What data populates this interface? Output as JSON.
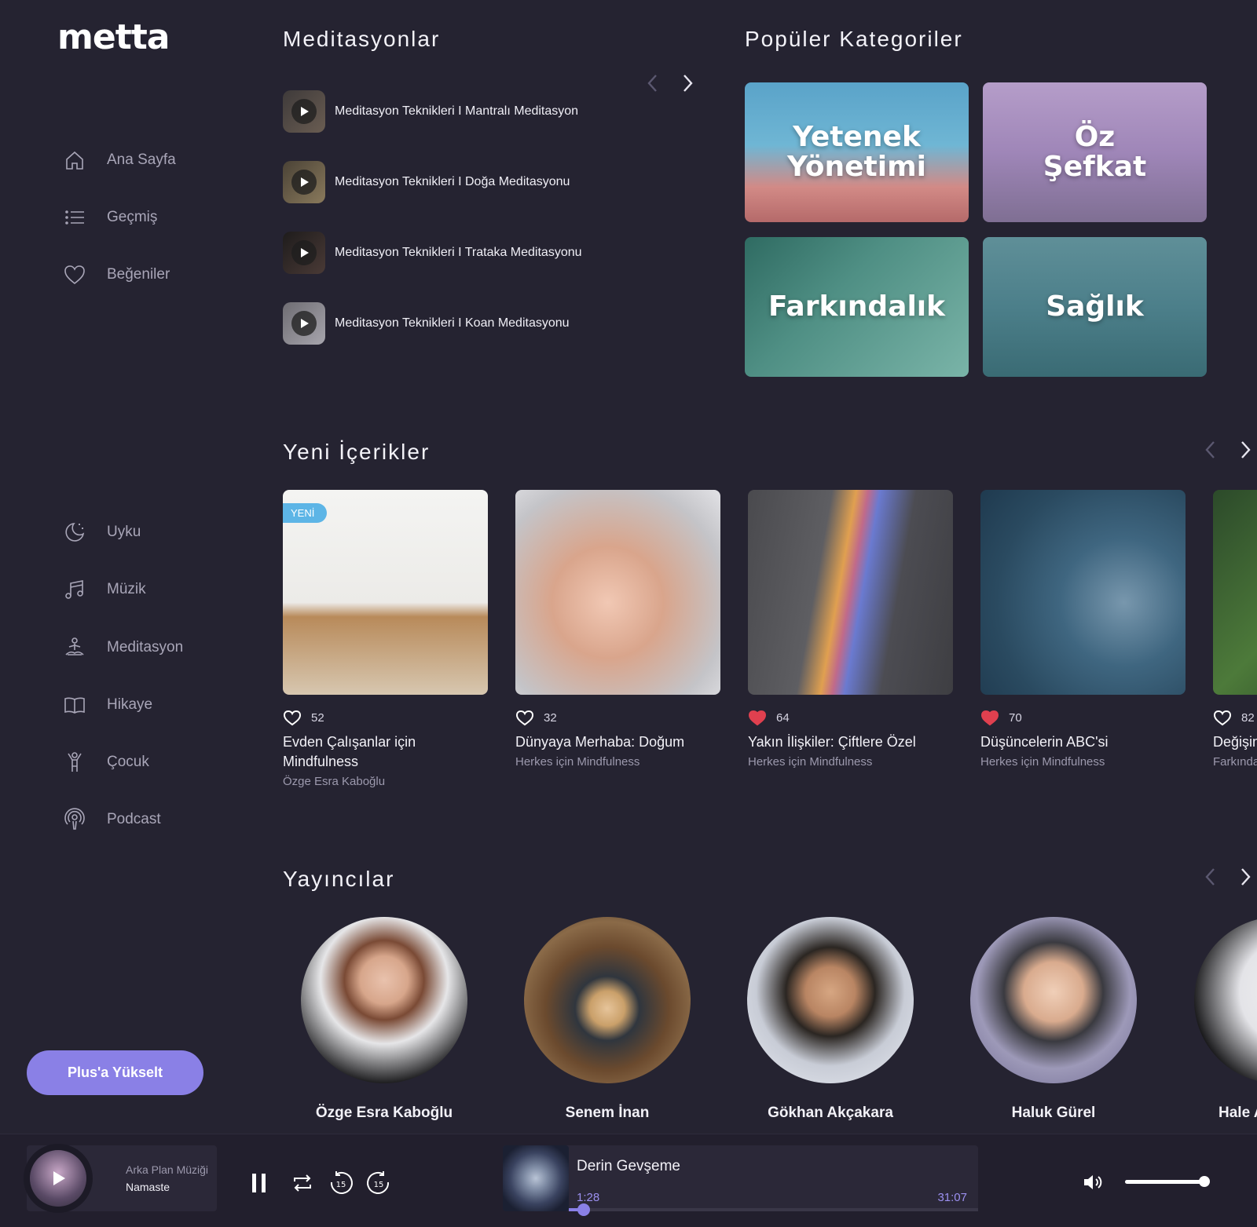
{
  "app": {
    "logo": "metta"
  },
  "sidebar": {
    "primary": [
      {
        "label": "Ana Sayfa",
        "icon": "home-icon"
      },
      {
        "label": "Geçmiş",
        "icon": "list-icon"
      },
      {
        "label": "Beğeniler",
        "icon": "heart-icon"
      }
    ],
    "categories": [
      {
        "label": "Uyku",
        "icon": "moon-icon"
      },
      {
        "label": "Müzik",
        "icon": "music-note-icon"
      },
      {
        "label": "Meditasyon",
        "icon": "meditation-icon"
      },
      {
        "label": "Hikaye",
        "icon": "book-icon"
      },
      {
        "label": "Çocuk",
        "icon": "child-icon"
      },
      {
        "label": "Podcast",
        "icon": "podcast-icon"
      }
    ],
    "upgrade_label": "Plus'a Yükselt"
  },
  "meditations": {
    "title": "Meditasyonlar",
    "items": [
      "Meditasyon Teknikleri I Mantralı Meditasyon",
      "Meditasyon Teknikleri I Doğa Meditasyonu",
      "Meditasyon Teknikleri I Trataka Meditasyonu",
      "Meditasyon Teknikleri I Koan Meditasyonu"
    ]
  },
  "popular": {
    "title": "Popüler Kategoriler",
    "items": [
      "Yetenek\nYönetimi",
      "Öz\nŞefkat",
      "Farkındalık",
      "Sağlık"
    ]
  },
  "new_content": {
    "title": "Yeni İçerikler",
    "badge": "YENİ",
    "items": [
      {
        "likes": "52",
        "liked": false,
        "title": "Evden Çalışanlar için Mindfulness",
        "subtitle": "Özge Esra Kaboğlu"
      },
      {
        "likes": "32",
        "liked": false,
        "title": "Dünyaya Merhaba: Doğum",
        "subtitle": "Herkes için Mindfulness"
      },
      {
        "likes": "64",
        "liked": true,
        "title": "Yakın İlişkiler: Çiftlere Özel",
        "subtitle": "Herkes için Mindfulness"
      },
      {
        "likes": "70",
        "liked": true,
        "title": "Düşüncelerin ABC'si",
        "subtitle": "Herkes için Mindfulness"
      },
      {
        "likes": "82",
        "liked": false,
        "title": "Değişim",
        "subtitle": "Farkında"
      }
    ]
  },
  "publishers": {
    "title": "Yayıncılar",
    "items": [
      "Özge Esra Kaboğlu",
      "Senem İnan",
      "Gökhan Akçakara",
      "Haluk Gürel",
      "Hale A"
    ]
  },
  "player": {
    "bg_music_label": "Arka Plan Müziği",
    "bg_music_track": "Namaste",
    "now_playing": "Derin Gevşeme",
    "elapsed": "1:28",
    "duration": "31:07",
    "progress": 0.025,
    "volume": 0.95,
    "skip_seconds": "15"
  },
  "colors": {
    "accent": "#8a80e6",
    "background": "#252331",
    "liked": "#e0404f",
    "badge": "#5db5e6"
  }
}
